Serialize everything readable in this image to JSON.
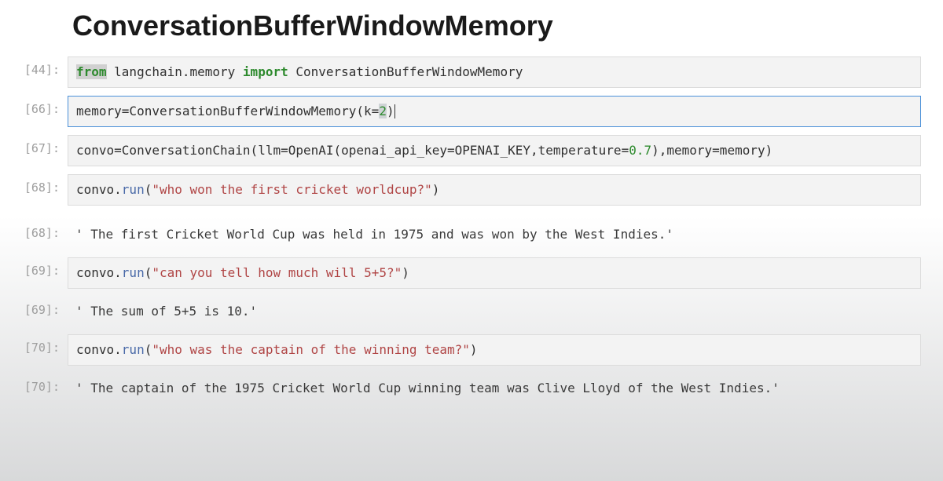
{
  "heading": "ConversationBufferWindowMemory",
  "cells": {
    "c44": {
      "prompt": "[44]:",
      "t_from": "from",
      "t_mod": " langchain.memory ",
      "t_import": "import",
      "t_name": " ConversationBufferWindowMemory"
    },
    "c66": {
      "prompt": "[66]:",
      "t_pre": "memory=ConversationBufferWindowMemory(k=",
      "t_k": "2",
      "t_post": ")"
    },
    "c67": {
      "prompt": "[67]:",
      "t_a": "convo=ConversationChain(llm=OpenAI(openai_api_key=OPENAI_KEY,temperature=",
      "t_temp": "0.7",
      "t_b": "),memory=memory)"
    },
    "c68in": {
      "prompt": "[68]:",
      "t_a": "convo.",
      "t_run": "run",
      "t_b": "(",
      "t_str": "\"who won the first cricket worldcup?\"",
      "t_c": ")"
    },
    "c68out": {
      "prompt": "[68]:",
      "text": "' The first Cricket World Cup was held in 1975 and was won by the West Indies.'"
    },
    "c69in": {
      "prompt": "[69]:",
      "t_a": "convo.",
      "t_run": "run",
      "t_b": "(",
      "t_str": "\"can you tell how much will 5+5?\"",
      "t_c": ")"
    },
    "c69out": {
      "prompt": "[69]:",
      "text": "' The sum of 5+5 is 10.'"
    },
    "c70in": {
      "prompt": "[70]:",
      "t_a": "convo.",
      "t_run": "run",
      "t_b": "(",
      "t_str": "\"who was the captain of the winning team?\"",
      "t_c": ")"
    },
    "c70out": {
      "prompt": "[70]:",
      "text": "' The captain of the 1975 Cricket World Cup winning team was Clive Lloyd of the West Indies.'"
    }
  }
}
